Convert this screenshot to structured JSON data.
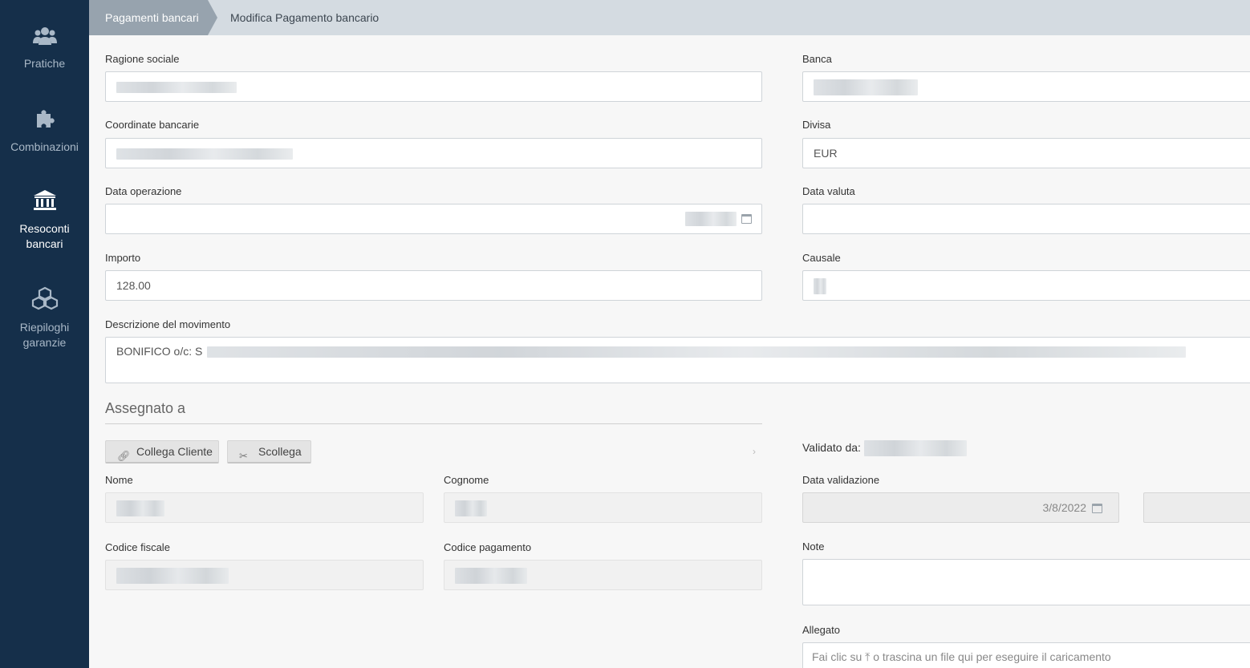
{
  "sidebar": {
    "items": [
      {
        "label": "Pratiche",
        "icon": "users-icon"
      },
      {
        "label": "Combinazioni",
        "icon": "puzzle-icon"
      },
      {
        "label_line1": "Resoconti",
        "label_line2": "bancari",
        "icon": "bank-icon",
        "active": true
      },
      {
        "label_line1": "Riepiloghi",
        "label_line2": "garanzie",
        "icon": "cubes-icon"
      }
    ]
  },
  "breadcrumb": {
    "parent": "Pagamenti bancari",
    "current": "Modifica Pagamento bancario"
  },
  "form": {
    "ragione_sociale_label": "Ragione sociale",
    "banca_label": "Banca",
    "coordinate_label": "Coordinate bancarie",
    "divisa_label": "Divisa",
    "divisa_value": "EUR",
    "data_operazione_label": "Data operazione",
    "data_valuta_label": "Data valuta",
    "importo_label": "Importo",
    "importo_value": "128.00",
    "causale_label": "Causale",
    "descrizione_label": "Descrizione del movimento",
    "descrizione_value": "BONIFICO o/c: S"
  },
  "assegnato": {
    "title": "Assegnato a",
    "collega_label": "Collega Cliente",
    "scollega_label": "Scollega",
    "nome_label": "Nome",
    "cognome_label": "Cognome",
    "codice_fiscale_label": "Codice fiscale",
    "codice_pagamento_label": "Codice pagamento"
  },
  "validazione": {
    "validato_label": "Validato da:",
    "data_validazione_label": "Data validazione",
    "data_validazione_value": "3/8/2022",
    "note_label": "Note",
    "allegato_label": "Allegato",
    "upload_prefix": "Fai clic su",
    "upload_suffix": "o trascina un file qui per eseguire il caricamento"
  },
  "colors": {
    "sidebar_bg": "#152f4a",
    "breadcrumb_active_bg": "#97a3ae",
    "breadcrumb_bar_bg": "#d4dbe1"
  }
}
